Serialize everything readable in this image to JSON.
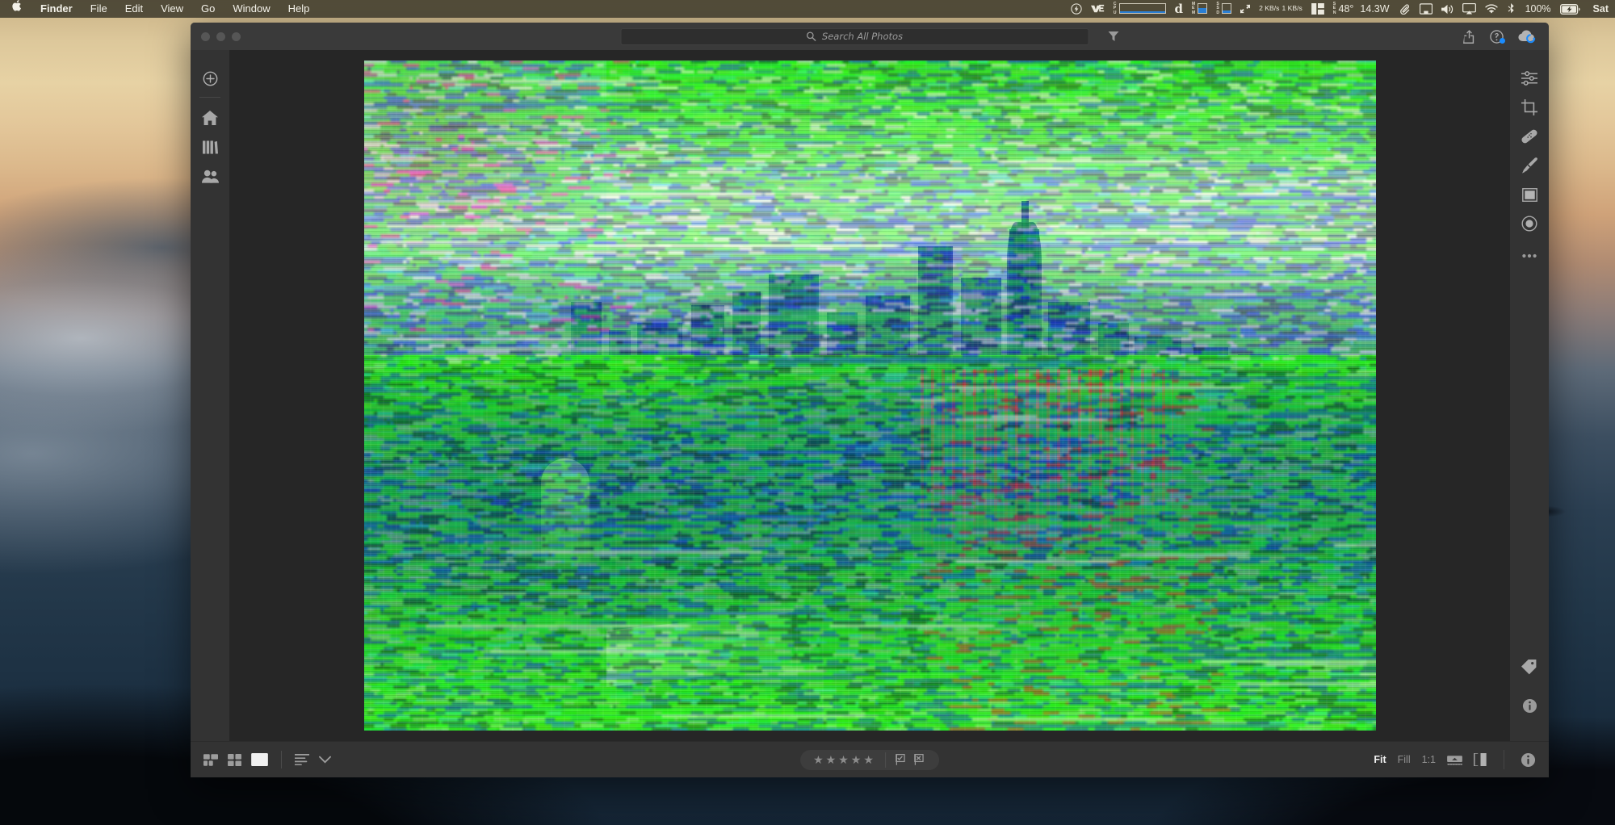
{
  "menubar": {
    "apple_glyph": "",
    "items": [
      {
        "label": "Finder",
        "bold": true
      },
      {
        "label": "File",
        "bold": false
      },
      {
        "label": "Edit",
        "bold": false
      },
      {
        "label": "View",
        "bold": false
      },
      {
        "label": "Go",
        "bold": false
      },
      {
        "label": "Window",
        "bold": false
      },
      {
        "label": "Help",
        "bold": false
      }
    ],
    "status": {
      "power_icon": "power-bolt-icon",
      "vpn_icon": "vpn-logo-icon",
      "cpu_label_lines": [
        "C",
        "P",
        "U"
      ],
      "cpu_fill_pct": 22,
      "disk_icon_letter": "d",
      "mem_label_lines": [
        "M",
        "E",
        "M"
      ],
      "mem_fill_pct": 55,
      "ssd_label_lines": [
        "S",
        "S",
        "D"
      ],
      "ssd_fill_pct": 30,
      "net_arrows_icon": "network-arrows-icon",
      "net_up": "2 KB/s",
      "net_down": "1 KB/s",
      "blocks_icon": "window-layout-icon",
      "sensor_label_lines": [
        "S",
        "E",
        "N"
      ],
      "temperature": "48°",
      "wattage": "14.3W",
      "clip_icon": "paperclip-icon",
      "display_icon": "display-icon",
      "volume_icon": "speaker-icon",
      "airplay_icon": "airplay-icon",
      "wifi_icon": "wifi-icon",
      "bluetooth_icon": "bluetooth-icon",
      "battery_pct": "100%",
      "battery_icon": "battery-charging-icon",
      "clock": "Sat"
    },
    "colors": {
      "bg": "#3e3a2c",
      "text": "#f2f0e8"
    }
  },
  "window": {
    "traffic_lights": [
      "close",
      "minimize",
      "zoom"
    ],
    "search": {
      "placeholder": "Search All Photos",
      "value": "",
      "icon": "search-icon",
      "filter_icon": "filter-funnel-icon"
    },
    "titlebar_right": [
      {
        "name": "share-button",
        "icon": "share-export-icon"
      },
      {
        "name": "help-button",
        "icon": "help-circle-icon",
        "badge": true
      },
      {
        "name": "cloud-sync-button",
        "icon": "cloud-sync-icon"
      }
    ],
    "accent_color": "#1a8cff"
  },
  "left_rail": {
    "items": [
      {
        "name": "add-button",
        "icon": "plus-circle-icon",
        "label": "Add",
        "active": false
      },
      {
        "name": "home-button",
        "icon": "home-icon",
        "label": "Home",
        "active": false
      },
      {
        "name": "library-button",
        "icon": "library-books-icon",
        "label": "Library",
        "active": false
      },
      {
        "name": "people-button",
        "icon": "people-icon",
        "label": "People",
        "active": false
      }
    ]
  },
  "right_rail": {
    "tools": [
      {
        "name": "adjust-tool",
        "icon": "sliders-icon",
        "label": "Adjust",
        "active": false
      },
      {
        "name": "crop-tool",
        "icon": "crop-icon",
        "label": "Crop",
        "active": false
      },
      {
        "name": "heal-tool",
        "icon": "bandage-icon",
        "label": "Healing Brush",
        "active": false
      },
      {
        "name": "brush-tool",
        "icon": "brush-icon",
        "label": "Brush",
        "active": false
      },
      {
        "name": "gradient-tool",
        "icon": "gradient-icon",
        "label": "Linear Gradient",
        "active": false
      },
      {
        "name": "radial-tool",
        "icon": "radial-icon",
        "label": "Radial Gradient",
        "active": false
      },
      {
        "name": "more-tool",
        "icon": "ellipsis-icon",
        "label": "More",
        "active": false
      }
    ],
    "bottom": [
      {
        "name": "tag-button",
        "icon": "tag-icon",
        "label": "Keywords"
      },
      {
        "name": "info-button",
        "icon": "info-circle-icon",
        "label": "Info"
      }
    ]
  },
  "bottom_bar": {
    "view_modes": [
      {
        "name": "grid-detail-view",
        "icon": "grid-detail-icon",
        "active": false
      },
      {
        "name": "grid-view",
        "icon": "grid-icon",
        "active": false
      },
      {
        "name": "single-view",
        "icon": "single-photo-icon",
        "active": true
      }
    ],
    "sort": {
      "name": "sort-button",
      "icon": "sort-lines-icon"
    },
    "sort_menu": {
      "name": "sort-menu-button",
      "icon": "chevron-down-icon"
    },
    "rating": {
      "stars_total": 5,
      "stars_filled": 0,
      "star_glyph": "★",
      "flag_pick_icon": "flag-pick-icon",
      "flag_reject_icon": "flag-reject-icon"
    },
    "zoom": {
      "options": [
        {
          "label": "Fit",
          "active": true
        },
        {
          "label": "Fill",
          "active": false
        },
        {
          "label": "1:1",
          "active": false
        }
      ],
      "filmstrip_icon": "filmstrip-icon",
      "compare_icon": "before-after-icon"
    },
    "info_icon": "info-circle-icon"
  },
  "photo": {
    "name": "glitched-skyline-photo",
    "description": "Heavily corrupted / datamoshed photograph of a city skyline across a river at dusk, rendered in saturated green, blue and magenta scanline noise"
  }
}
